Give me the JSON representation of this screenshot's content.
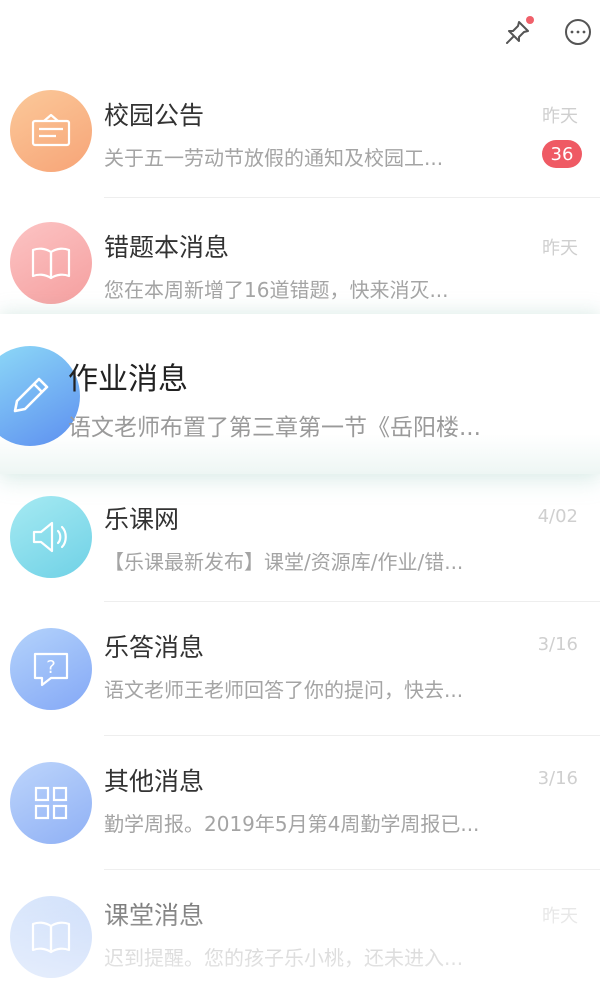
{
  "messages": [
    {
      "title": "校园公告",
      "preview": "关于五一劳动节放假的通知及校园工...",
      "time": "昨天",
      "badge": "36",
      "icon": "notice-board-icon",
      "color_from": "#fbc99a",
      "color_to": "#f7a477"
    },
    {
      "title": "错题本消息",
      "preview": "您在本周新增了16道错题，快来消灭...",
      "time": "昨天",
      "icon": "book-icon",
      "color_from": "#fcc4c4",
      "color_to": "#f59f9f"
    },
    {
      "title": "作业消息",
      "preview": "语文老师布置了第三章第一节《岳阳楼...",
      "icon": "pencil-icon",
      "color_from": "#8fdcf7",
      "color_to": "#5d8ff0"
    },
    {
      "title": "乐课网",
      "preview": "【乐课最新发布】课堂/资源库/作业/错...",
      "time": "4/02",
      "icon": "speaker-icon",
      "color_from": "#a6eaf2",
      "color_to": "#6fd1e6"
    },
    {
      "title": "乐答消息",
      "preview": "语文老师王老师回答了你的提问，快去...",
      "time": "3/16",
      "icon": "question-icon",
      "color_from": "#b4d3fb",
      "color_to": "#84a8f6"
    },
    {
      "title": "其他消息",
      "preview": "勤学周报。2019年5月第4周勤学周报已...",
      "time": "3/16",
      "icon": "grid-icon",
      "color_from": "#bdd5fb",
      "color_to": "#8fb0f5"
    },
    {
      "title": "课堂消息",
      "preview": "迟到提醒。您的孩子乐小桃，还未进入...",
      "time": "昨天",
      "icon": "book-icon",
      "color_from": "#d2e2fb",
      "color_to": "#b3cbf7"
    }
  ]
}
